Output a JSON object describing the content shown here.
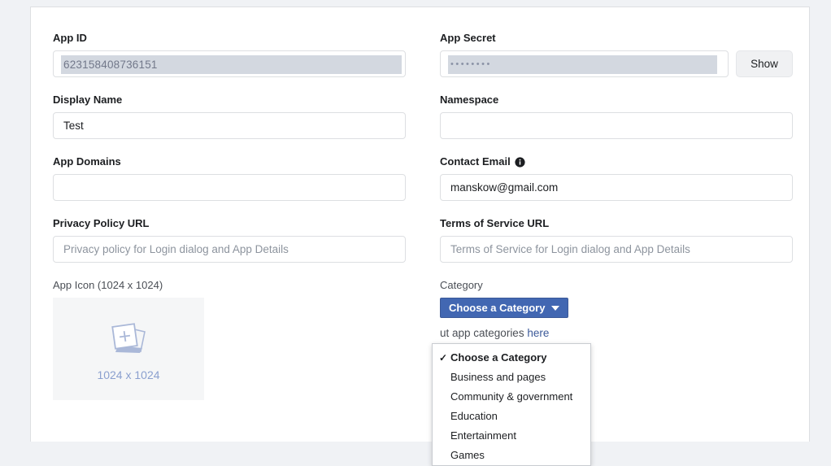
{
  "form": {
    "app_id": {
      "label": "App ID",
      "value": "623158408736151"
    },
    "app_secret": {
      "label": "App Secret",
      "value": "••••••••",
      "show_button": "Show"
    },
    "display_name": {
      "label": "Display Name",
      "value": "Test"
    },
    "namespace": {
      "label": "Namespace",
      "value": ""
    },
    "app_domains": {
      "label": "App Domains",
      "value": ""
    },
    "contact_email": {
      "label": "Contact Email",
      "value": "manskow@gmail.com",
      "info_icon": "info-icon"
    },
    "privacy_policy_url": {
      "label": "Privacy Policy URL",
      "placeholder": "Privacy policy for Login dialog and App Details",
      "value": ""
    },
    "terms_of_service_url": {
      "label": "Terms of Service URL",
      "placeholder": "Terms of Service for Login dialog and App Details",
      "value": ""
    },
    "app_icon": {
      "label": "App Icon (1024 x 1024)",
      "placeholder_caption": "1024 x 1024",
      "upload_icon": "add-photo-icon"
    },
    "category": {
      "label": "Category",
      "button_label": "Choose a Category",
      "caret_icon": "chevron-down-icon",
      "help_text_visible": "ut app categories",
      "help_link": "here"
    }
  },
  "category_menu": {
    "check_icon": "check-icon",
    "items": [
      {
        "label": "Choose a Category",
        "selected": true
      },
      {
        "label": "Business and pages",
        "selected": false
      },
      {
        "label": "Community & government",
        "selected": false
      },
      {
        "label": "Education",
        "selected": false
      },
      {
        "label": "Entertainment",
        "selected": false
      },
      {
        "label": "Games",
        "selected": false
      }
    ]
  },
  "colors": {
    "accent": "#4267b2",
    "page_background": "#f0f2f5",
    "card_background": "#ffffff",
    "selection_highlight": "#d3d8e0",
    "placeholder_text": "#8d949e"
  }
}
